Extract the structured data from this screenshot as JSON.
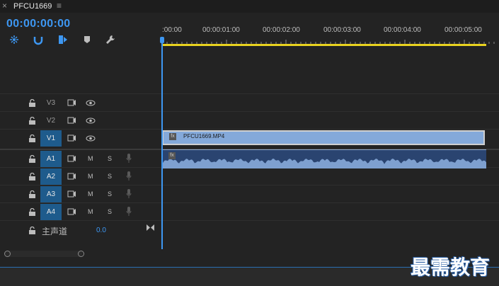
{
  "tab": {
    "close_icon": "close-icon",
    "title": "PFCU1669",
    "menu_icon": "menu-icon"
  },
  "timecode": "00:00:00:00",
  "tools": [
    "snap-icon",
    "link-icon",
    "marker-add-icon",
    "marker-icon",
    "wrench-icon"
  ],
  "ruler": {
    "labels": [
      ":00:00",
      "00:00:01:00",
      "00:00:02:00",
      "00:00:03:00",
      "00:00:04:00",
      "00:00:05:00"
    ]
  },
  "video_tracks": [
    {
      "name": "V3",
      "active": false
    },
    {
      "name": "V2",
      "active": false
    },
    {
      "name": "V1",
      "active": true
    }
  ],
  "audio_tracks": [
    {
      "name": "A1",
      "mute": "M",
      "solo": "S"
    },
    {
      "name": "A2",
      "mute": "M",
      "solo": "S"
    },
    {
      "name": "A3",
      "mute": "M",
      "solo": "S"
    },
    {
      "name": "A4",
      "mute": "M",
      "solo": "S"
    }
  ],
  "master": {
    "label": "主声道",
    "value": "0.0"
  },
  "clips": {
    "video": {
      "name": "PFCU1669.MP4",
      "fx": "fx"
    },
    "audio": {
      "fx": "fx"
    }
  },
  "watermark": "最需教育",
  "colors": {
    "accent": "#3d97f2",
    "workarea": "#e8d21f",
    "clip_video": "#84a9da",
    "track_active": "#1e5b8c"
  }
}
